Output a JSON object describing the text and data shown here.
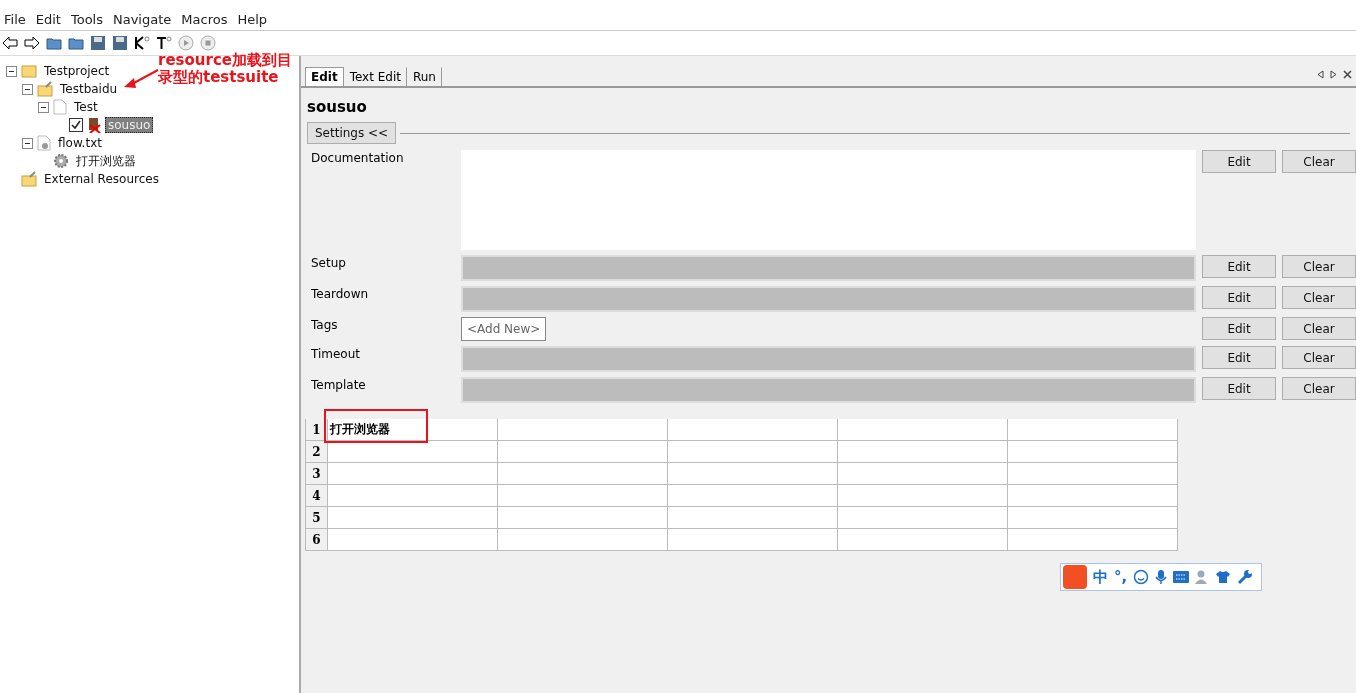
{
  "menu": [
    "File",
    "Edit",
    "Tools",
    "Navigate",
    "Macros",
    "Help"
  ],
  "tree": [
    {
      "label": "Testproject",
      "kind": "folder",
      "expanded": true,
      "selected": false,
      "children": [
        {
          "label": "Testbaidu",
          "kind": "resource-folder",
          "expanded": true,
          "selected": false,
          "children": [
            {
              "label": "Test",
              "kind": "file",
              "expanded": true,
              "selected": false,
              "children": [
                {
                  "label": "sousuo",
                  "kind": "test",
                  "checked": true,
                  "selected": true
                }
              ]
            }
          ]
        },
        {
          "label": "flow.txt",
          "kind": "resource-file",
          "expanded": true,
          "selected": false,
          "children": [
            {
              "label": "打开浏览器",
              "kind": "keyword",
              "selected": false
            }
          ]
        }
      ]
    },
    {
      "label": "External Resources",
      "kind": "resource-folder",
      "selected": false
    }
  ],
  "annotation": {
    "text": "resource加载到目录型的testsuite"
  },
  "tabs": [
    {
      "label": "Edit",
      "selected": true
    },
    {
      "label": "Text Edit",
      "selected": false
    },
    {
      "label": "Run",
      "selected": false
    }
  ],
  "editor": {
    "title": "sousuo",
    "settings_button": "Settings <<",
    "settings": [
      {
        "label": "Documentation",
        "kind": "doc",
        "buttons": [
          "Edit",
          "Clear"
        ]
      },
      {
        "label": "Setup",
        "kind": "field",
        "buttons": [
          "Edit",
          "Clear"
        ]
      },
      {
        "label": "Teardown",
        "kind": "field",
        "buttons": [
          "Edit",
          "Clear"
        ]
      },
      {
        "label": "Tags",
        "kind": "tags",
        "add": "<Add New>",
        "buttons": [
          "Edit",
          "Clear"
        ]
      },
      {
        "label": "Timeout",
        "kind": "field",
        "buttons": [
          "Edit",
          "Clear"
        ]
      },
      {
        "label": "Template",
        "kind": "field",
        "buttons": [
          "Edit",
          "Clear"
        ]
      }
    ]
  },
  "grid": {
    "rows": [
      {
        "number": "1",
        "cells": [
          "打开浏览器",
          "",
          "",
          "",
          ""
        ]
      },
      {
        "number": "2",
        "cells": [
          "",
          "",
          "",
          "",
          ""
        ]
      },
      {
        "number": "3",
        "cells": [
          "",
          "",
          "",
          "",
          ""
        ]
      },
      {
        "number": "4",
        "cells": [
          "",
          "",
          "",
          "",
          ""
        ]
      },
      {
        "number": "5",
        "cells": [
          "",
          "",
          "",
          "",
          ""
        ]
      },
      {
        "number": "6",
        "cells": [
          "",
          "",
          "",
          "",
          ""
        ]
      }
    ]
  },
  "ime": {
    "mode": "中",
    "punct": "°,"
  }
}
